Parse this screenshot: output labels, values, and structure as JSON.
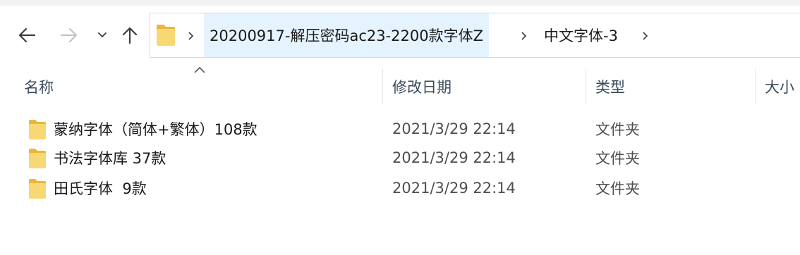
{
  "nav": {
    "back_icon": "arrow-left-icon",
    "forward_icon": "arrow-right-icon",
    "recent_icon": "chevron-down-icon",
    "up_icon": "arrow-up-icon"
  },
  "address": {
    "folder_icon": "folder-icon",
    "crumbs": [
      {
        "label": "20200917-解压密码ac23-2200款字体Z"
      },
      {
        "label": "中文字体-3"
      }
    ]
  },
  "columns": {
    "name": "名称",
    "date": "修改日期",
    "type": "类型",
    "size": "大小"
  },
  "sort": {
    "column": "name",
    "direction": "ascending"
  },
  "files": [
    {
      "name": "蒙纳字体（简体+繁体）108款",
      "date": "2021/3/29 22:14",
      "type": "文件夹"
    },
    {
      "name": "书法字体库 37款",
      "date": "2021/3/29 22:14",
      "type": "文件夹"
    },
    {
      "name": "田氏字体  9款",
      "date": "2021/3/29 22:14",
      "type": "文件夹"
    }
  ],
  "colors": {
    "folder": "#f8d775",
    "folder_dark": "#e8b73c",
    "breadcrumb_highlight": "#e5f3ff"
  }
}
